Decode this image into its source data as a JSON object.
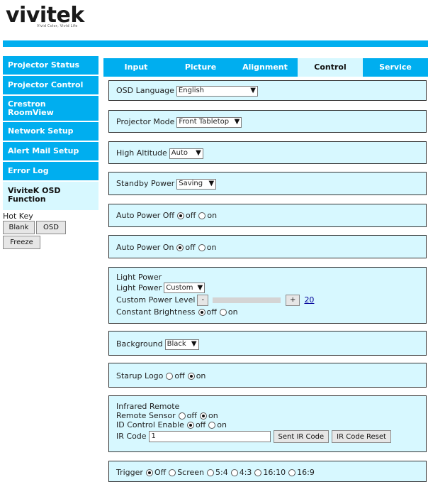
{
  "brand": {
    "name": "vivitek",
    "tagline": "Vivid Color, Vivid Life"
  },
  "colors": {
    "accent": "#00aeef",
    "panel_bg": "#d7f8ff",
    "active_bg": "#d7f8ff",
    "link": "#000099"
  },
  "sidebar": {
    "items": [
      {
        "label": "Projector Status"
      },
      {
        "label": "Projector Control"
      },
      {
        "label_line1": "Crestron",
        "label_line2": "RoomView"
      },
      {
        "label": "Network Setup"
      },
      {
        "label": "Alert Mail Setup"
      },
      {
        "label": "Error Log"
      },
      {
        "label_line1": "ViviteK OSD",
        "label_line2": "Function"
      }
    ],
    "hotkey": {
      "title": "Hot Key",
      "blank": "Blank",
      "osd": "OSD",
      "freeze": "Freeze"
    }
  },
  "tabs": [
    "Input",
    "Picture",
    "Alignment",
    "Control",
    "Service"
  ],
  "active_tab": "Control",
  "control": {
    "osd_language": {
      "label": "OSD Language",
      "value": "English"
    },
    "projector_mode": {
      "label": "Projector Mode",
      "value": "Front Tabletop"
    },
    "high_altitude": {
      "label": "High Altitude",
      "value": "Auto"
    },
    "standby_power": {
      "label": "Standby Power",
      "value": "Saving"
    },
    "auto_power_off": {
      "label": "Auto Power Off",
      "off": "off",
      "on": "on",
      "selected": "off"
    },
    "auto_power_on": {
      "label": "Auto Power On",
      "off": "off",
      "on": "on",
      "selected": "off"
    },
    "light_power": {
      "title": "Light Power",
      "mode_label": "Light Power",
      "mode_value": "Custom",
      "custom_label": "Custom Power Level",
      "minus": "-",
      "plus": "+",
      "level": "20",
      "brightness_label": "Constant Brightness",
      "off": "off",
      "on": "on",
      "selected": "off"
    },
    "background": {
      "label": "Background",
      "value": "Black"
    },
    "startup_logo": {
      "label": "Starup Logo",
      "off": "off",
      "on": "on",
      "selected": "on"
    },
    "infrared": {
      "title": "Infrared Remote",
      "sensor_label": "Remote Sensor",
      "sensor_off": "off",
      "sensor_on": "on",
      "sensor_selected": "on",
      "id_label": "ID Control Enable",
      "id_off": "off",
      "id_on": "on",
      "id_selected": "off",
      "ir_code_label": "IR Code",
      "ir_code_value": "1",
      "send_button": "Sent IR Code",
      "reset_button": "IR Code Reset"
    },
    "trigger": {
      "label": "Trigger",
      "options": [
        "Off",
        "Screen",
        "5:4",
        "4:3",
        "16:10",
        "16:9"
      ],
      "selected": "Off"
    }
  }
}
